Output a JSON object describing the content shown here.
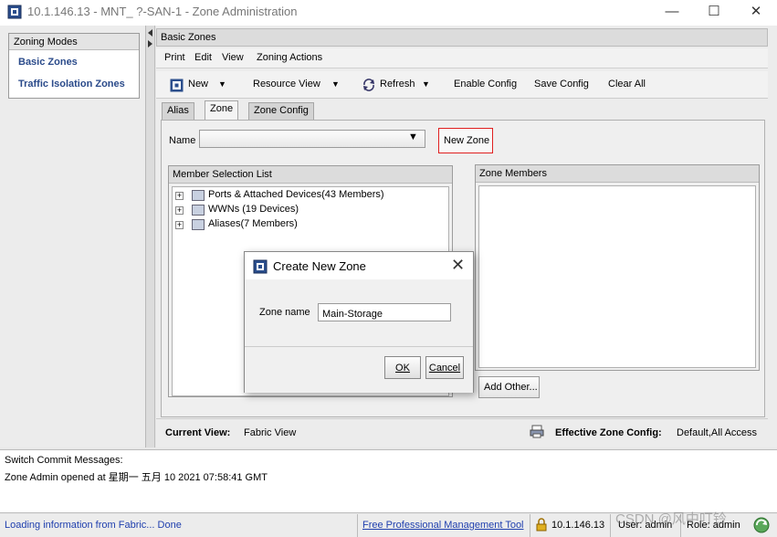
{
  "window": {
    "title": "10.1.146.13 - MNT_ ?-SAN-1 - Zone Administration",
    "minimize_glyph": "—",
    "maximize_glyph": "☐",
    "close_glyph": "✕"
  },
  "left_panel": {
    "header": "Zoning Modes",
    "items": [
      {
        "label": "Basic Zones"
      },
      {
        "label": "Traffic Isolation Zones"
      }
    ]
  },
  "main": {
    "header": "Basic Zones",
    "menu": [
      "Print",
      "Edit",
      "View",
      "Zoning Actions"
    ],
    "toolbar": {
      "new": "New",
      "resource_view": "Resource View",
      "refresh": "Refresh",
      "enable_config": "Enable Config",
      "save_config": "Save Config",
      "clear_all": "Clear All"
    },
    "tabs": [
      "Alias",
      "Zone",
      "Zone Config"
    ],
    "active_tab": "Zone",
    "name_label": "Name",
    "new_zone_button": "New Zone",
    "member_selection": {
      "title": "Member Selection List",
      "items": [
        {
          "label": "Ports & Attached Devices(43 Members)",
          "icon": "ports-icon"
        },
        {
          "label": "WWNs (19 Devices)",
          "icon": "wwn-icon"
        },
        {
          "label": "Aliases(7 Members)",
          "icon": "alias-icon"
        }
      ]
    },
    "zone_members_title": "Zone Members",
    "add_other_button": "Add Other...",
    "current_view_label": "Current View:",
    "current_view_value": "Fabric View",
    "effective_zone_label": "Effective Zone Config:",
    "effective_zone_value": "Default,All Access"
  },
  "commit": {
    "header": "Switch Commit Messages:",
    "message": "Zone Admin opened at 星期一 五月 10 2021 07:58:41 GMT"
  },
  "status": {
    "left": "Loading information from Fabric... Done",
    "link": "Free Professional Management Tool",
    "ip": "10.1.146.13",
    "user": "User: admin",
    "role": "Role: admin",
    "watermark": "CSDN @风中叮铃"
  },
  "dialog": {
    "title": "Create New Zone",
    "zone_name_label": "Zone name",
    "zone_name_value": "Main-Storage",
    "ok": "OK",
    "cancel": "Cancel"
  },
  "colors": {
    "link_blue": "#1f3fae",
    "nav_blue": "#2a4a8a",
    "highlight_red": "#e02020"
  }
}
